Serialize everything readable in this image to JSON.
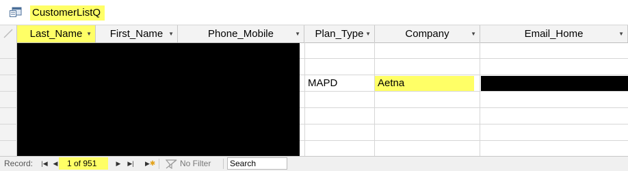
{
  "window": {
    "title": "CustomerListQ",
    "icon": "query-datasheet-icon"
  },
  "grid": {
    "columns": [
      {
        "name": "Last_Name",
        "highlighted": true
      },
      {
        "name": "First_Name",
        "highlighted": false
      },
      {
        "name": "Phone_Mobile",
        "highlighted": false
      },
      {
        "name": "Plan_Type",
        "highlighted": false
      },
      {
        "name": "Company",
        "highlighted": false
      },
      {
        "name": "Email_Home",
        "highlighted": false
      }
    ],
    "visible_row_3": {
      "plan_type": "MAPD",
      "company": "Aetna"
    },
    "redactions": "black-box"
  },
  "navigation": {
    "record_label": "Record:",
    "record_position": "1 of 951",
    "no_filter_label": "No Filter",
    "search_value": "Search"
  },
  "colors": {
    "highlight": "#ffff66",
    "header_bg": "#f3f3f3",
    "redaction": "#000000"
  }
}
